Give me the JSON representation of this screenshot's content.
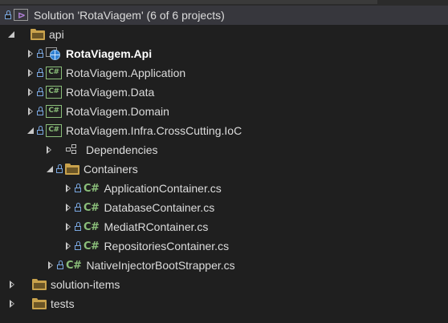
{
  "solution": {
    "title": "Solution 'RotaViagem' (6 of 6 projects)"
  },
  "tree": {
    "api_folder": "api",
    "projects": {
      "api": "RotaViagem.Api",
      "application": "RotaViagem.Application",
      "data": "RotaViagem.Data",
      "domain": "RotaViagem.Domain",
      "ioc": "RotaViagem.Infra.CrossCutting.IoC"
    },
    "ioc_children": {
      "dependencies": "Dependencies",
      "containers_folder": "Containers",
      "files": [
        "ApplicationContainer.cs",
        "DatabaseContainer.cs",
        "MediatRContainer.cs",
        "RepositoriesContainer.cs"
      ],
      "bootstrapper": "NativeInjectorBootStrapper.cs"
    },
    "solution_items": "solution-items",
    "tests": "tests"
  },
  "icons": {
    "csproj_glyph": "C#",
    "cs_glyph": "C#",
    "vs_glyph": "⊳"
  },
  "colors": {
    "background": "#1f1f1f",
    "selected_row": "#37373d",
    "folder": "#c9a24c",
    "csharp": "#8bbf7a",
    "lock": "#7aa7e0",
    "web_globe": "#2f7fd1",
    "vs_purple": "#b180d7"
  }
}
